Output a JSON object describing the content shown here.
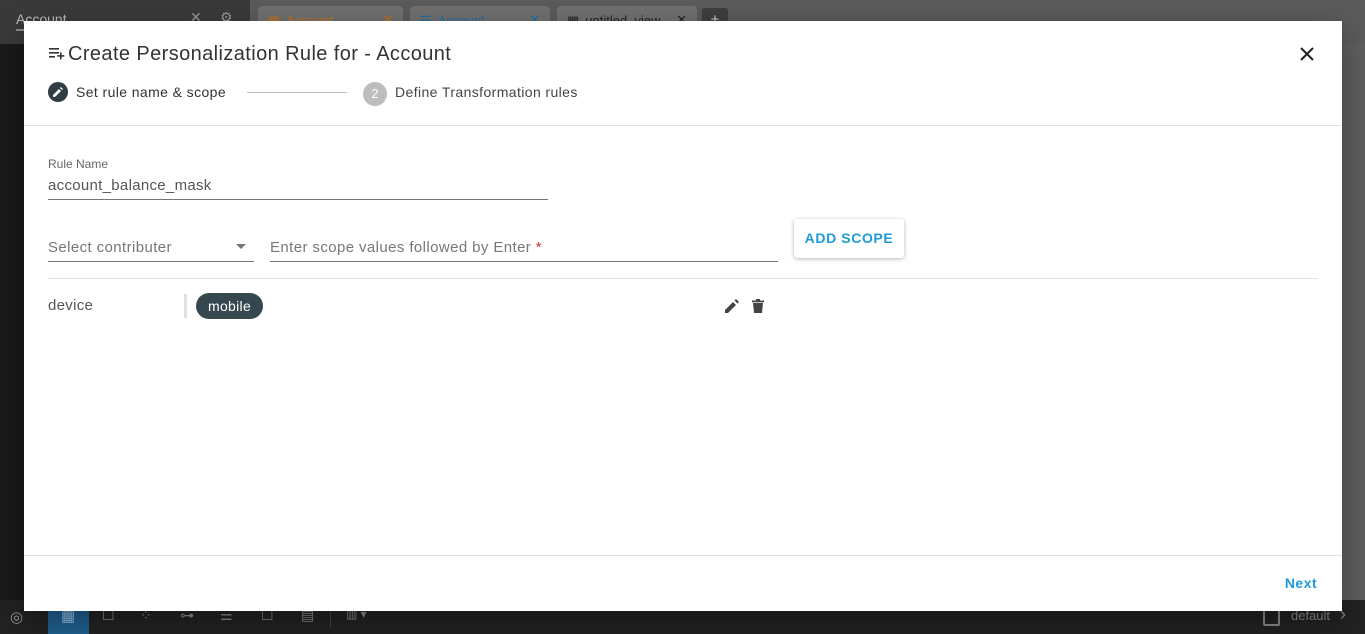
{
  "background": {
    "left_panel_title": "Account",
    "tabs": [
      {
        "label": "Account",
        "icon": "grid-icon",
        "color": "#c0701a"
      },
      {
        "label": "Account",
        "icon": "list-icon",
        "color": "#1f6fa3"
      },
      {
        "label": "untitled_view",
        "icon": "grid-icon",
        "color": "#222222"
      }
    ],
    "bottom_bar": {
      "layout_label": "",
      "default_label": "default"
    }
  },
  "dialog": {
    "title": "Create Personalization Rule for - Account",
    "stepper": {
      "step1_label": "Set rule name & scope",
      "step2_number": "2",
      "step2_label": "Define Transformation rules"
    },
    "rule_name": {
      "label": "Rule Name",
      "value": "account_balance_mask"
    },
    "contributor_select": {
      "placeholder": "Select contributer"
    },
    "scope_input": {
      "placeholder": "Enter scope values followed by Enter",
      "required_mark": "*"
    },
    "add_scope_label": "ADD SCOPE",
    "scopes": [
      {
        "key": "device",
        "values": [
          "mobile"
        ]
      }
    ],
    "next_label": "Next"
  },
  "colors": {
    "accent": "#1e9bd7",
    "chip": "#37474f",
    "required": "#d32f2f"
  }
}
